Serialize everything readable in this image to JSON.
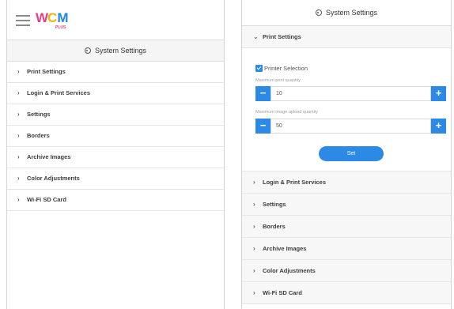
{
  "left": {
    "logo": {
      "w": "W",
      "c": "C",
      "m": "M",
      "plus": "PLUS"
    },
    "header": {
      "title": "System Settings"
    },
    "menu": [
      {
        "label": "Print Settings"
      },
      {
        "label": "Login & Print Services"
      },
      {
        "label": "Settings"
      },
      {
        "label": "Borders"
      },
      {
        "label": "Archive Images"
      },
      {
        "label": "Color Adjustments"
      },
      {
        "label": "Wi-Fi SD Card"
      }
    ]
  },
  "right": {
    "header": {
      "title": "System Settings"
    },
    "print_settings": {
      "label": "Print Settings",
      "printer_selection": {
        "label": "Printer Selection",
        "checked": true
      },
      "max_print": {
        "label": "Maximum print quantity",
        "value": "10",
        "minus": "−",
        "plus": "+"
      },
      "max_upload": {
        "label": "Maximum image upload quantity",
        "value": "50",
        "minus": "−",
        "plus": "+"
      },
      "set_label": "Set"
    },
    "menu": [
      {
        "label": "Login & Print Services"
      },
      {
        "label": "Settings"
      },
      {
        "label": "Borders"
      },
      {
        "label": "Archive Images"
      },
      {
        "label": "Color Adjustments"
      },
      {
        "label": "Wi-Fi SD Card"
      }
    ]
  },
  "colors": {
    "accent": "#2c8ae6",
    "logo_pink": "#e83e8c",
    "logo_yellow": "#f0b500",
    "logo_blue": "#1e88e5"
  }
}
